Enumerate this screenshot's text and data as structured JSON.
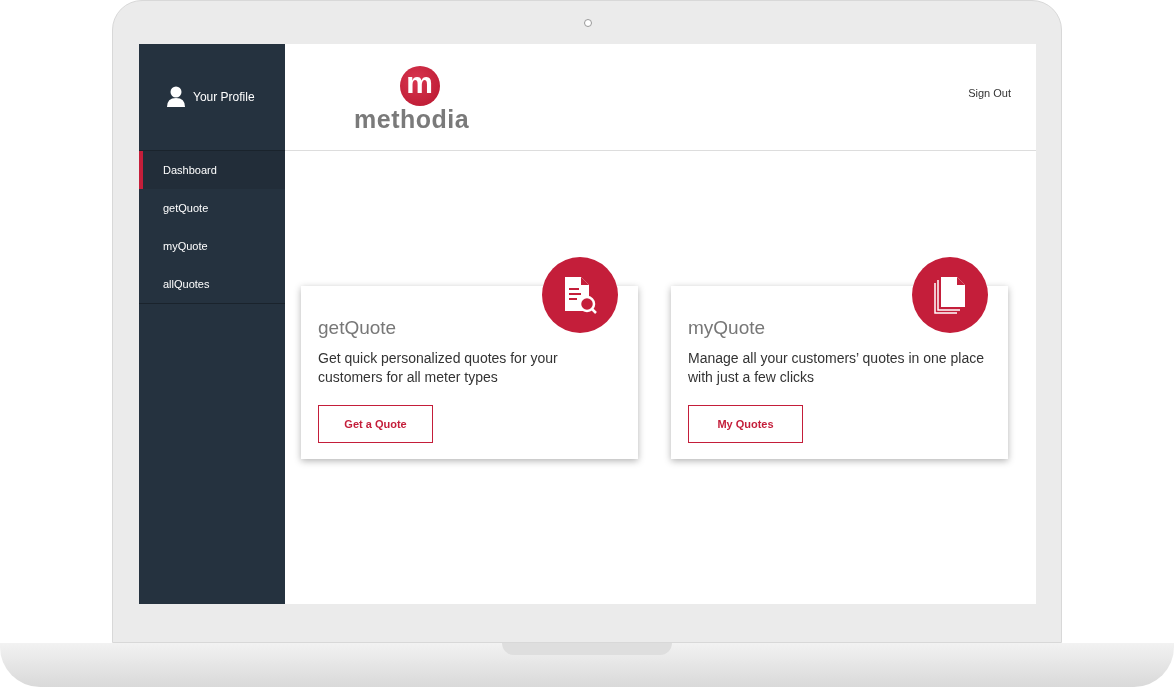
{
  "sidebar": {
    "profile": {
      "label": "Your Profile"
    },
    "items": [
      {
        "label": "Dashboard",
        "selected": true
      },
      {
        "label": "getQuote",
        "selected": false
      },
      {
        "label": "myQuote",
        "selected": false
      },
      {
        "label": "allQuotes",
        "selected": false
      }
    ]
  },
  "header": {
    "logo": {
      "mark": "m",
      "wordmark": "methodia"
    },
    "sign_out": "Sign Out"
  },
  "cards": [
    {
      "title": "getQuote",
      "description": "Get quick personalized quotes for your customers for all meter types",
      "button": "Get a Quote"
    },
    {
      "title": "myQuote",
      "description": "Manage all your customers’ quotes in one place with just a few clicks",
      "button": "My Quotes"
    }
  ]
}
